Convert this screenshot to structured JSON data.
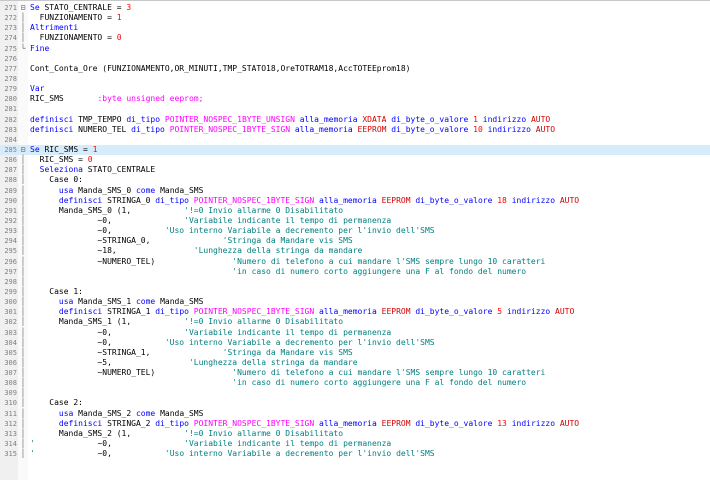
{
  "editor": {
    "lines": [
      {
        "n": "271",
        "fold": "⊟",
        "hl": false,
        "segs": [
          {
            "t": "Se ",
            "c": "k"
          },
          {
            "t": "STATO_CENTRALE = ",
            "c": ""
          },
          {
            "t": "3",
            "c": "r"
          }
        ]
      },
      {
        "n": "272",
        "fold": "│",
        "hl": false,
        "segs": [
          {
            "t": "  FUNZIONAMENTO = ",
            "c": ""
          },
          {
            "t": "1",
            "c": "r"
          }
        ]
      },
      {
        "n": "273",
        "fold": "│",
        "hl": false,
        "segs": [
          {
            "t": "Altrimenti",
            "c": "k"
          }
        ]
      },
      {
        "n": "274",
        "fold": "│",
        "hl": false,
        "segs": [
          {
            "t": "  FUNZIONAMENTO = ",
            "c": ""
          },
          {
            "t": "0",
            "c": "r"
          }
        ]
      },
      {
        "n": "275",
        "fold": "└",
        "hl": false,
        "segs": [
          {
            "t": "Fine",
            "c": "k"
          }
        ]
      },
      {
        "n": "276",
        "fold": "",
        "hl": false,
        "segs": []
      },
      {
        "n": "277",
        "fold": "",
        "hl": false,
        "segs": [
          {
            "t": "Cont_Conta_Ore (FUNZIONAMENTO,OR_MINUTI,TMP_STATO18,OreTOTRAM18,AccTOTEEprom18)",
            "c": ""
          }
        ]
      },
      {
        "n": "278",
        "fold": "",
        "hl": false,
        "segs": []
      },
      {
        "n": "279",
        "fold": "",
        "hl": false,
        "segs": [
          {
            "t": "Var",
            "c": "k"
          }
        ]
      },
      {
        "n": "280",
        "fold": "",
        "hl": false,
        "segs": [
          {
            "t": "RIC_SMS       ",
            "c": ""
          },
          {
            "t": ":byte unsigned eeprom;",
            "c": "m"
          }
        ]
      },
      {
        "n": "281",
        "fold": "",
        "hl": false,
        "segs": []
      },
      {
        "n": "282",
        "fold": "",
        "hl": false,
        "segs": [
          {
            "t": "definisci ",
            "c": "k"
          },
          {
            "t": "TMP_TEMPO ",
            "c": ""
          },
          {
            "t": "di_tipo ",
            "c": "k"
          },
          {
            "t": "POINTER_NOSPEC_1BYTE_UNSIGN ",
            "c": "m"
          },
          {
            "t": "alla_memoria ",
            "c": "k"
          },
          {
            "t": "XDATA ",
            "c": "red"
          },
          {
            "t": "di_byte_o_valore ",
            "c": "k"
          },
          {
            "t": "1 ",
            "c": "r"
          },
          {
            "t": "indirizzo ",
            "c": "k"
          },
          {
            "t": "AUTO",
            "c": "red"
          }
        ]
      },
      {
        "n": "283",
        "fold": "",
        "hl": false,
        "segs": [
          {
            "t": "definisci ",
            "c": "k"
          },
          {
            "t": "NUMERO_TEL ",
            "c": ""
          },
          {
            "t": "di_tipo ",
            "c": "k"
          },
          {
            "t": "POINTER_NOSPEC_1BYTE_SIGN ",
            "c": "m"
          },
          {
            "t": "alla_memoria ",
            "c": "k"
          },
          {
            "t": "EEPROM ",
            "c": "red"
          },
          {
            "t": "di_byte_o_valore ",
            "c": "k"
          },
          {
            "t": "10 ",
            "c": "r"
          },
          {
            "t": "indirizzo ",
            "c": "k"
          },
          {
            "t": "AUTO",
            "c": "red"
          }
        ]
      },
      {
        "n": "284",
        "fold": "",
        "hl": false,
        "segs": []
      },
      {
        "n": "285",
        "fold": "⊟",
        "hl": true,
        "segs": [
          {
            "t": "Se ",
            "c": "k"
          },
          {
            "t": "RIC_SMS = ",
            "c": ""
          },
          {
            "t": "1",
            "c": "r"
          }
        ]
      },
      {
        "n": "286",
        "fold": "│",
        "hl": false,
        "segs": [
          {
            "t": "  RIC_SMS = ",
            "c": ""
          },
          {
            "t": "0",
            "c": "r"
          }
        ]
      },
      {
        "n": "287",
        "fold": "│",
        "hl": false,
        "segs": [
          {
            "t": "  Seleziona ",
            "c": "k"
          },
          {
            "t": "STATO_CENTRALE",
            "c": ""
          }
        ]
      },
      {
        "n": "288",
        "fold": "│",
        "hl": false,
        "segs": [
          {
            "t": "    Case 0:",
            "c": ""
          }
        ]
      },
      {
        "n": "289",
        "fold": "│",
        "hl": false,
        "segs": [
          {
            "t": "      usa ",
            "c": "k"
          },
          {
            "t": "Manda_SMS_0 ",
            "c": ""
          },
          {
            "t": "come ",
            "c": "k"
          },
          {
            "t": "Manda_SMS",
            "c": ""
          }
        ]
      },
      {
        "n": "290",
        "fold": "│",
        "hl": false,
        "segs": [
          {
            "t": "      definisci ",
            "c": "k"
          },
          {
            "t": "STRINGA_0 ",
            "c": ""
          },
          {
            "t": "di_tipo ",
            "c": "k"
          },
          {
            "t": "POINTER_NOSPEC_1BYTE_SIGN ",
            "c": "m"
          },
          {
            "t": "alla_memoria ",
            "c": "k"
          },
          {
            "t": "EEPROM ",
            "c": "red"
          },
          {
            "t": "di_byte_o_valore ",
            "c": "k"
          },
          {
            "t": "18 ",
            "c": "r"
          },
          {
            "t": "indirizzo ",
            "c": "k"
          },
          {
            "t": "AUTO",
            "c": "red"
          }
        ]
      },
      {
        "n": "291",
        "fold": "│",
        "hl": false,
        "segs": [
          {
            "t": "      Manda_SMS_0 (1,           ",
            "c": ""
          },
          {
            "t": "'!=0 Invio allarme 0 Disabilitato",
            "c": "c"
          }
        ]
      },
      {
        "n": "292",
        "fold": "│",
        "hl": false,
        "segs": [
          {
            "t": "              ~0,               ",
            "c": ""
          },
          {
            "t": "'Variabile indicante il tempo di permanenza",
            "c": "c"
          }
        ]
      },
      {
        "n": "293",
        "fold": "│",
        "hl": false,
        "segs": [
          {
            "t": "              ~0,           ",
            "c": ""
          },
          {
            "t": "'Uso interno Variabile a decremento per l'invio dell'SMS",
            "c": "c"
          }
        ]
      },
      {
        "n": "294",
        "fold": "│",
        "hl": false,
        "segs": [
          {
            "t": "              ~STRINGA_0,               ",
            "c": ""
          },
          {
            "t": "'Stringa da Mandare vis SMS",
            "c": "c"
          }
        ]
      },
      {
        "n": "295",
        "fold": "│",
        "hl": false,
        "segs": [
          {
            "t": "              ~18,                ",
            "c": ""
          },
          {
            "t": "'Lunghezza della stringa da mandare",
            "c": "c"
          }
        ]
      },
      {
        "n": "296",
        "fold": "│",
        "hl": false,
        "segs": [
          {
            "t": "              ~NUMERO_TEL)                ",
            "c": ""
          },
          {
            "t": "'Numero di telefono a cui mandare l'SMS sempre lungo 10 caratteri",
            "c": "c"
          }
        ]
      },
      {
        "n": "297",
        "fold": "│",
        "hl": false,
        "segs": [
          {
            "t": "                                          ",
            "c": ""
          },
          {
            "t": "'in caso di numero corto aggiungere una F al fondo del numero",
            "c": "c"
          }
        ]
      },
      {
        "n": "298",
        "fold": "│",
        "hl": false,
        "segs": []
      },
      {
        "n": "299",
        "fold": "│",
        "hl": false,
        "segs": [
          {
            "t": "    Case 1:",
            "c": ""
          }
        ]
      },
      {
        "n": "300",
        "fold": "│",
        "hl": false,
        "segs": [
          {
            "t": "      usa ",
            "c": "k"
          },
          {
            "t": "Manda_SMS_1 ",
            "c": ""
          },
          {
            "t": "come ",
            "c": "k"
          },
          {
            "t": "Manda_SMS",
            "c": ""
          }
        ]
      },
      {
        "n": "301",
        "fold": "│",
        "hl": false,
        "segs": [
          {
            "t": "      definisci ",
            "c": "k"
          },
          {
            "t": "STRINGA_1 ",
            "c": ""
          },
          {
            "t": "di_tipo ",
            "c": "k"
          },
          {
            "t": "POINTER_NOSPEC_1BYTE_SIGN ",
            "c": "m"
          },
          {
            "t": "alla_memoria ",
            "c": "k"
          },
          {
            "t": "EEPROM ",
            "c": "red"
          },
          {
            "t": "di_byte_o_valore ",
            "c": "k"
          },
          {
            "t": "5 ",
            "c": "r"
          },
          {
            "t": "indirizzo ",
            "c": "k"
          },
          {
            "t": "AUTO",
            "c": "red"
          }
        ]
      },
      {
        "n": "302",
        "fold": "│",
        "hl": false,
        "segs": [
          {
            "t": "      Manda_SMS_1 (1,           ",
            "c": ""
          },
          {
            "t": "'!=0 Invio allarme 0 Disabilitato",
            "c": "c"
          }
        ]
      },
      {
        "n": "303",
        "fold": "│",
        "hl": false,
        "segs": [
          {
            "t": "              ~0,               ",
            "c": ""
          },
          {
            "t": "'Variabile indicante il tempo di permanenza",
            "c": "c"
          }
        ]
      },
      {
        "n": "304",
        "fold": "│",
        "hl": false,
        "segs": [
          {
            "t": "              ~0,           ",
            "c": ""
          },
          {
            "t": "'Uso interno Variabile a decremento per l'invio dell'SMS",
            "c": "c"
          }
        ]
      },
      {
        "n": "305",
        "fold": "│",
        "hl": false,
        "segs": [
          {
            "t": "              ~STRINGA_1,               ",
            "c": ""
          },
          {
            "t": "'Stringa da Mandare vis SMS",
            "c": "c"
          }
        ]
      },
      {
        "n": "306",
        "fold": "│",
        "hl": false,
        "segs": [
          {
            "t": "              ~5,                ",
            "c": ""
          },
          {
            "t": "'Lunghezza della stringa da mandare",
            "c": "c"
          }
        ]
      },
      {
        "n": "307",
        "fold": "│",
        "hl": false,
        "segs": [
          {
            "t": "              ~NUMERO_TEL)                ",
            "c": ""
          },
          {
            "t": "'Numero di telefono a cui mandare l'SMS sempre lungo 10 caratteri",
            "c": "c"
          }
        ]
      },
      {
        "n": "308",
        "fold": "│",
        "hl": false,
        "segs": [
          {
            "t": "                                          ",
            "c": ""
          },
          {
            "t": "'in caso di numero corto aggiungere una F al fondo del numero",
            "c": "c"
          }
        ]
      },
      {
        "n": "309",
        "fold": "│",
        "hl": false,
        "segs": []
      },
      {
        "n": "310",
        "fold": "│",
        "hl": false,
        "segs": [
          {
            "t": "    Case 2:",
            "c": ""
          }
        ]
      },
      {
        "n": "311",
        "fold": "│",
        "hl": false,
        "segs": [
          {
            "t": "      usa ",
            "c": "k"
          },
          {
            "t": "Manda_SMS_2 ",
            "c": ""
          },
          {
            "t": "come ",
            "c": "k"
          },
          {
            "t": "Manda_SMS",
            "c": ""
          }
        ]
      },
      {
        "n": "312",
        "fold": "│",
        "hl": false,
        "segs": [
          {
            "t": "      definisci ",
            "c": "k"
          },
          {
            "t": "STRINGA_2 ",
            "c": ""
          },
          {
            "t": "di_tipo ",
            "c": "k"
          },
          {
            "t": "POINTER_NOSPEC_1BYTE_SIGN ",
            "c": "m"
          },
          {
            "t": "alla_memoria ",
            "c": "k"
          },
          {
            "t": "EEPROM ",
            "c": "red"
          },
          {
            "t": "di_byte_o_valore ",
            "c": "k"
          },
          {
            "t": "13 ",
            "c": "r"
          },
          {
            "t": "indirizzo ",
            "c": "k"
          },
          {
            "t": "AUTO",
            "c": "red"
          }
        ]
      },
      {
        "n": "313",
        "fold": "│",
        "hl": false,
        "segs": [
          {
            "t": "      Manda_SMS_2 (1,           ",
            "c": ""
          },
          {
            "t": "'!=0 Invio allarme 0 Disabilitato",
            "c": "c"
          }
        ]
      },
      {
        "n": "314",
        "fold": "│",
        "hl": false,
        "segs": [
          {
            "t": "'",
            "c": "c"
          },
          {
            "t": "             ~0,               ",
            "c": ""
          },
          {
            "t": "'Variabile indicante il tempo di permanenza",
            "c": "c"
          }
        ]
      },
      {
        "n": "315",
        "fold": "│",
        "hl": false,
        "segs": [
          {
            "t": "'",
            "c": "c"
          },
          {
            "t": "             ~0,           ",
            "c": ""
          },
          {
            "t": "'Uso interno Variabile a decremento per l'invio dell'SMS",
            "c": "c"
          }
        ]
      }
    ]
  }
}
